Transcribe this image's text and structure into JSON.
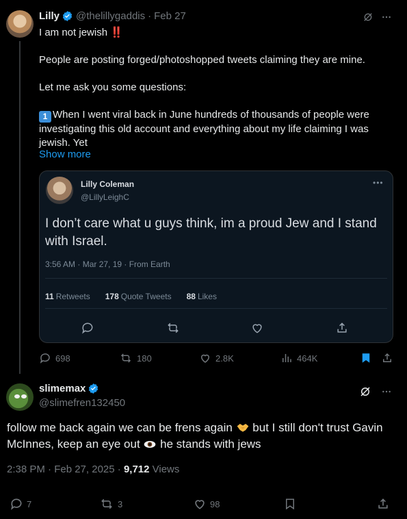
{
  "tweet1": {
    "name": "Lilly",
    "handle": "@thelillygaddis",
    "dot": "·",
    "date": "Feb 27",
    "line1": "I am not jewish",
    "line1_emoji": "‼️",
    "line2": "People are posting forged/photoshopped tweets claiming they are mine.",
    "line3": "Let me ask you some questions:",
    "line4_keycap": "1",
    "line4": "When I went viral back in June hundreds of thousands of people were investigating this old account and everything about my life claiming I was jewish. Yet",
    "show_more": "Show more",
    "media": {
      "name": "Lilly Coleman",
      "handle": "@LillyLeighC",
      "more": "•••",
      "text": "I don’t care what u guys think, im a proud Jew and I stand with Israel.",
      "meta": "3:56 AM · Mar 27, 19 · From Earth",
      "retweets_count": "11",
      "retweets_label": "Retweets",
      "quotes_count": "178",
      "quotes_label": "Quote Tweets",
      "likes_count": "88",
      "likes_label": "Likes"
    },
    "actions": {
      "replies": "698",
      "reposts": "180",
      "likes": "2.8K",
      "views": "464K"
    },
    "colors": {
      "link": "#1d9bf0",
      "bookmark_active": "#1d9bf0",
      "verified": "#1d9bf0"
    }
  },
  "tweet2": {
    "name": "slimemax",
    "handle": "@slimefren132450",
    "body_part1": "follow me back again we can be frens again",
    "body_part2": "but I still don't trust Gavin McInnes, keep an eye out",
    "body_part3": "he stands with jews",
    "emoji1": "handshake",
    "emoji2": "eye",
    "time": "2:38 PM · Feb 27, 2025 · ",
    "views_count": "9,712",
    "views_label": " Views",
    "actions": {
      "replies": "7",
      "reposts": "3",
      "likes": "98"
    }
  },
  "icons": [
    "grok-icon",
    "more-icon",
    "reply-icon",
    "repost-icon",
    "like-icon",
    "views-icon",
    "bookmark-icon",
    "share-icon",
    "verified-icon"
  ]
}
